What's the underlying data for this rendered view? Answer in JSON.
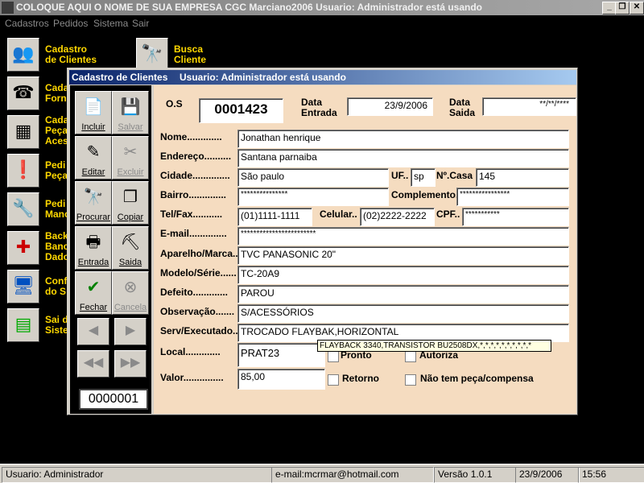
{
  "app": {
    "title": "COLOQUE AQUI O NOME DE SUA EMPRESA    CGC Marciano2006    Usuario: Administrador  está usando",
    "min_glyph": "_",
    "max_glyph": "❐",
    "close_glyph": "✕"
  },
  "menu": [
    "Cadastros",
    "Pedidos",
    "Sistema",
    "Sair"
  ],
  "desktop": {
    "items": [
      {
        "label1": "Cadastro",
        "label2": "de Clientes",
        "icon": "people-icon"
      },
      {
        "label1": "Busca",
        "label2": "Cliente",
        "icon": "binoculars-icon"
      },
      {
        "label1": "Cada",
        "label2": "Forn",
        "icon": "phone-person-icon"
      },
      {
        "label1": "Cada",
        "label2": "Peça",
        "label3": "Aces",
        "icon": "chip-icon"
      },
      {
        "label1": "Pedi",
        "label2": "Peça",
        "icon": "alert-icon"
      },
      {
        "label1": "Pedi",
        "label2": "Mano",
        "icon": "tools-icon"
      },
      {
        "label1": "Back",
        "label2": "Banc",
        "label3": "Dado",
        "icon": "disk-icon"
      },
      {
        "label1": "Conf",
        "label2": "do S",
        "icon": "monitor-icon"
      },
      {
        "label1": "Sai d",
        "label2": "Siste",
        "icon": "terminal-icon"
      }
    ]
  },
  "window": {
    "title": "Cadastro de Clientes",
    "subtitle": "Usuario: Administrador  está usando"
  },
  "toolbar": {
    "incluir": "Incluir",
    "salvar": "Salvar",
    "editar": "Editar",
    "excluir": "Excluir",
    "procurar": "Procurar",
    "copiar": "Copiar",
    "entrada": "Entrada",
    "saida": "Saida",
    "fechar": "Fechar",
    "cancela": "Cancela",
    "counter": "0000001"
  },
  "form": {
    "os_label": "O.S",
    "os_value": "0001423",
    "data_entrada_label1": "Data",
    "data_entrada_label2": "Entrada",
    "data_entrada_value": "23/9/2006",
    "data_saida_label1": "Data",
    "data_saida_label2": "Saida",
    "data_saida_value": "**/**/****",
    "nome_label": "Nome.............",
    "nome": "Jonathan henrique",
    "endereco_label": "Endereço..........",
    "endereco": "Santana parnaiba",
    "cidade_label": "Cidade..............",
    "cidade": "São paulo",
    "uf_label": "UF..",
    "uf": "sp",
    "ncasa_label": "Nº.Casa",
    "ncasa": "145",
    "bairro_label": "Bairro..............",
    "bairro": "***************",
    "complemento_label": "Complemento..",
    "complemento": "****************",
    "telfax_label": "Tel/Fax...........",
    "telfax": "(01)1111-1111",
    "celular_label": "Celular..",
    "celular": "(02)2222-2222",
    "cpf_label": "CPF..",
    "cpf": "***********",
    "email_label": "E-mail..............",
    "email": "************************",
    "aparelho_label": "Aparelho/Marca..",
    "aparelho": "TVC PANASONIC 20\"",
    "modelo_label": "Modelo/Série......",
    "modelo": "TC-20A9",
    "defeito_label": "Defeito.............",
    "defeito": "PAROU",
    "observacao_label": "Observação.......",
    "observacao": "S/ACESSÓRIOS",
    "serv_label": "Serv/Executado..",
    "serv": "TROCADO FLAYBAK,HORIZONTAL",
    "local_label": "Local.............",
    "local": "PRAT23",
    "pronto_label": "Pronto",
    "autoriza_label": "Autoriza",
    "valor_label": "Valor...............",
    "valor": "85,00",
    "retorno_label": "Retorno",
    "naotem_label": "Não tem peça/compensa",
    "tooltip": "FLAYBACK 3340,TRANSISTOR BU2508DX,*,*,*,*,*,*,*,*,*,*"
  },
  "status": {
    "user": "Usuario: Administrador",
    "email": "e-mail:mcrmar@hotmail.com",
    "version": "Versão 1.0.1",
    "date": "23/9/2006",
    "time": "15:56"
  }
}
